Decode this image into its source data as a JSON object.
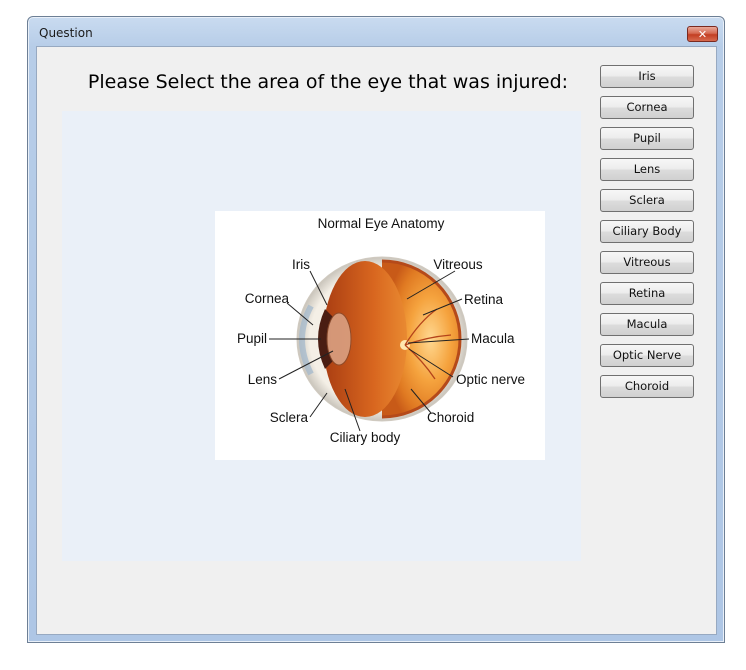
{
  "window": {
    "title": "Question"
  },
  "prompt": "Please Select the area of the eye that was injured:",
  "diagram": {
    "title": "Normal Eye Anatomy",
    "labels": {
      "iris": "Iris",
      "vitreous": "Vitreous",
      "cornea": "Cornea",
      "retina": "Retina",
      "pupil": "Pupil",
      "macula": "Macula",
      "lens": "Lens",
      "optic_nerve": "Optic nerve",
      "sclera": "Sclera",
      "choroid": "Choroid",
      "ciliary_body": "Ciliary body"
    }
  },
  "choices": [
    "Iris",
    "Cornea",
    "Pupil",
    "Lens",
    "Sclera",
    "Ciliary Body",
    "Vitreous",
    "Retina",
    "Macula",
    "Optic Nerve",
    "Choroid"
  ],
  "icons": {
    "close": "close-icon"
  },
  "colors": {
    "close_button": "#c84b2f",
    "panel": "#eaf0f8",
    "frame": "#b7cde8"
  }
}
